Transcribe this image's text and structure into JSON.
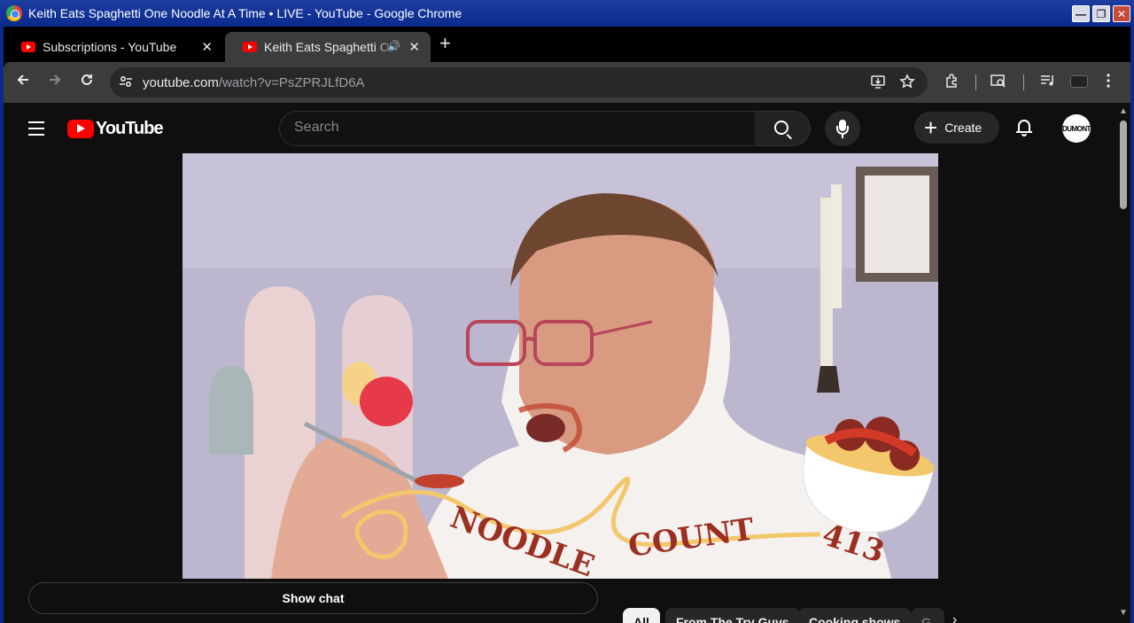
{
  "window": {
    "title": "Keith Eats Spaghetti One Noodle At A Time • LIVE - YouTube - Google Chrome",
    "minimize": "—",
    "maximize": "❐",
    "close": "✕"
  },
  "tabs": [
    {
      "label": "Subscriptions - YouTube",
      "close": "✕"
    },
    {
      "label": "Keith Eats Spaghetti One Noodle At A Time • LIVE - YouTube",
      "close": "✕",
      "audio": "🔊"
    }
  ],
  "new_tab": "+",
  "toolbar": {
    "url_host": "youtube.com",
    "url_path": "/watch?v=PsZPRJLfD6A"
  },
  "youtube": {
    "logo_text": "YouTube",
    "search_placeholder": "Search",
    "create_label": "Create",
    "avatar_text": "DUMONT"
  },
  "video": {
    "overlay_word1": "NOODLE",
    "overlay_word2": "COUNT",
    "noodle_count": "413"
  },
  "below_video": {
    "show_chat": "Show chat",
    "chips": [
      "All",
      "From The Try Guys",
      "Cooking shows",
      "G"
    ]
  },
  "colors": {
    "brand_red": "#ff0000",
    "titlebar": "#0a2a8e",
    "background": "#0f0f0f"
  }
}
